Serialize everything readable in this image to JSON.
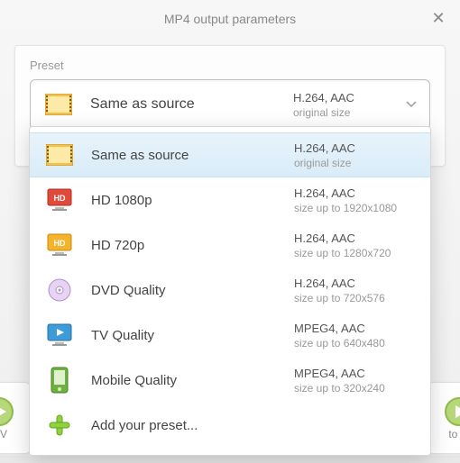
{
  "title": "MP4 output parameters",
  "preset_label": "Preset",
  "selected": {
    "icon": "film",
    "title": "Same as source",
    "codec": "H.264, AAC",
    "size": "original size"
  },
  "options": [
    {
      "icon": "film",
      "title": "Same as source",
      "codec": "H.264, AAC",
      "size": "original size",
      "selected": true
    },
    {
      "icon": "hd-red",
      "title": "HD 1080p",
      "codec": "H.264, AAC",
      "size": "size up to 1920x1080",
      "selected": false
    },
    {
      "icon": "hd-yel",
      "title": "HD 720p",
      "codec": "H.264, AAC",
      "size": "size up to 1280x720",
      "selected": false
    },
    {
      "icon": "disc",
      "title": "DVD Quality",
      "codec": "H.264, AAC",
      "size": "size up to 720x576",
      "selected": false
    },
    {
      "icon": "tv",
      "title": "TV Quality",
      "codec": "MPEG4, AAC",
      "size": "size up to 640x480",
      "selected": false
    },
    {
      "icon": "phone",
      "title": "Mobile Quality",
      "codec": "MPEG4, AAC",
      "size": "size up to 320x240",
      "selected": false
    }
  ],
  "add_preset_label": "Add your preset...",
  "bg_thumbs": {
    "left": "MV",
    "right": "to M"
  }
}
